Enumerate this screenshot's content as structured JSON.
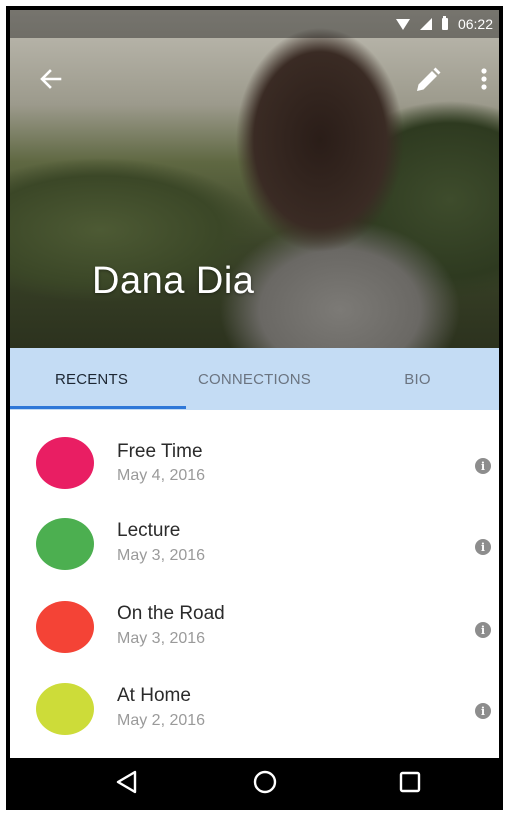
{
  "status_bar": {
    "time": "06:22"
  },
  "profile": {
    "name": "Dana Dia"
  },
  "tabs": [
    {
      "label": "RECENTS",
      "active": true
    },
    {
      "label": "CONNECTIONS",
      "active": false
    },
    {
      "label": "BIO",
      "active": false
    }
  ],
  "recents": [
    {
      "title": "Free Time",
      "date": "May 4, 2016",
      "color": "#e91e63"
    },
    {
      "title": "Lecture",
      "date": "May 3, 2016",
      "color": "#4caf50"
    },
    {
      "title": "On the Road",
      "date": "May 3, 2016",
      "color": "#f44336"
    },
    {
      "title": "At Home",
      "date": "May 2, 2016",
      "color": "#cddc39"
    }
  ],
  "icons": {
    "back": "arrow-left-icon",
    "edit": "pencil-icon",
    "more": "more-vert-icon",
    "info": "info-icon"
  },
  "theme": {
    "tab_background": "#c4dcf4",
    "tab_indicator": "#2f78d8"
  }
}
